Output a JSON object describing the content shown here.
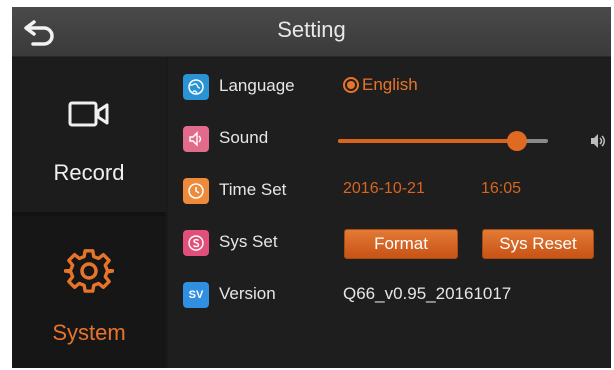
{
  "header": {
    "title": "Setting",
    "back_icon": "back-arrow-icon"
  },
  "sidebar": {
    "items": [
      {
        "label": "Record",
        "icon": "video-camera-icon",
        "active": false
      },
      {
        "label": "System",
        "icon": "gear-icon",
        "active": true
      }
    ]
  },
  "settings": {
    "language": {
      "label": "Language",
      "icon": "globe-icon",
      "selected": "English"
    },
    "sound": {
      "label": "Sound",
      "icon": "speaker-icon",
      "level_percent": 85
    },
    "time_set": {
      "label": "Time Set",
      "icon": "clock-icon",
      "date": "2016-10-21",
      "time": "16:05"
    },
    "sys_set": {
      "label": "Sys Set",
      "icon": "s-icon",
      "format_label": "Format",
      "reset_label": "Sys Reset"
    },
    "version": {
      "label": "Version",
      "icon_text": "SV",
      "value": "Q66_v0.95_20161017"
    }
  },
  "colors": {
    "accent": "#e8742a",
    "background": "#1e1e1e",
    "header": "#3f3f3f",
    "text": "#e6e6e6"
  }
}
